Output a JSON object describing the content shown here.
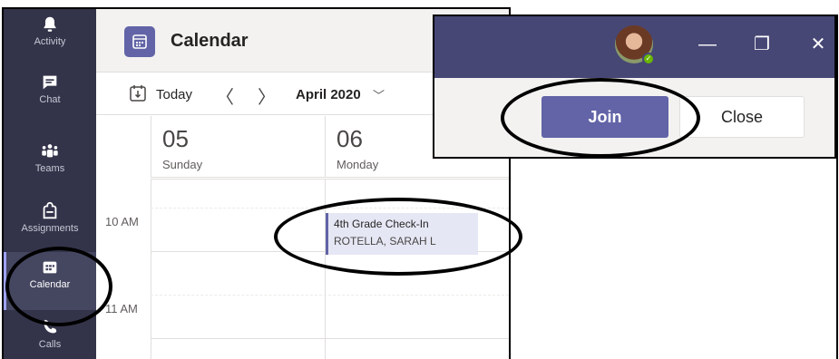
{
  "rail": {
    "items": [
      {
        "label": "Activity",
        "icon": "bell-icon"
      },
      {
        "label": "Chat",
        "icon": "chat-icon"
      },
      {
        "label": "Teams",
        "icon": "teams-icon"
      },
      {
        "label": "Assignments",
        "icon": "backpack-icon"
      },
      {
        "label": "Calendar",
        "icon": "calendar-icon",
        "active": true
      },
      {
        "label": "Calls",
        "icon": "phone-icon"
      }
    ]
  },
  "header": {
    "title": "Calendar"
  },
  "toolbar": {
    "today_label": "Today",
    "prev": "〈",
    "next": "〉",
    "month": "April 2020",
    "month_chevron": "﹀"
  },
  "days": [
    {
      "num": "05",
      "name": "Sunday"
    },
    {
      "num": "06",
      "name": "Monday"
    }
  ],
  "times": [
    "10 AM",
    "11 AM"
  ],
  "event": {
    "title": "4th Grade Check-In",
    "organizer": "ROTELLA, SARAH L"
  },
  "inset": {
    "min_glyph": "—",
    "max_glyph": "❐",
    "close_glyph": "✕",
    "join_label": "Join",
    "close_label": "Close"
  },
  "colors": {
    "rail": "#33344a",
    "accent": "#6264a7",
    "titlebar": "#464775",
    "presence": "#6bb700"
  }
}
